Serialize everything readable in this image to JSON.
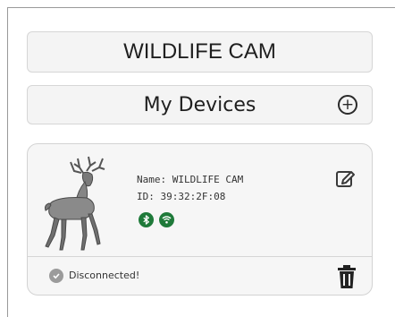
{
  "app": {
    "title": "WILDLIFE CAM"
  },
  "devices_header": {
    "label": "My Devices",
    "add_icon": "plus-circle-icon"
  },
  "device": {
    "name_text": "Name:  WILDLIFE CAM",
    "id_text": "ID:  39:32:2F:08",
    "bluetooth_icon": "bluetooth-icon",
    "wifi_icon": "wifi-icon",
    "status_text": "Disconnected!",
    "status_icon": "check-circle-icon",
    "edit_icon": "edit-icon",
    "delete_icon": "trash-icon"
  },
  "colors": {
    "accent_green": "#1f7a3a",
    "status_gray": "#9b9b9b",
    "bar_bg": "#f4f4f4",
    "card_bg": "#f6f6f6"
  }
}
